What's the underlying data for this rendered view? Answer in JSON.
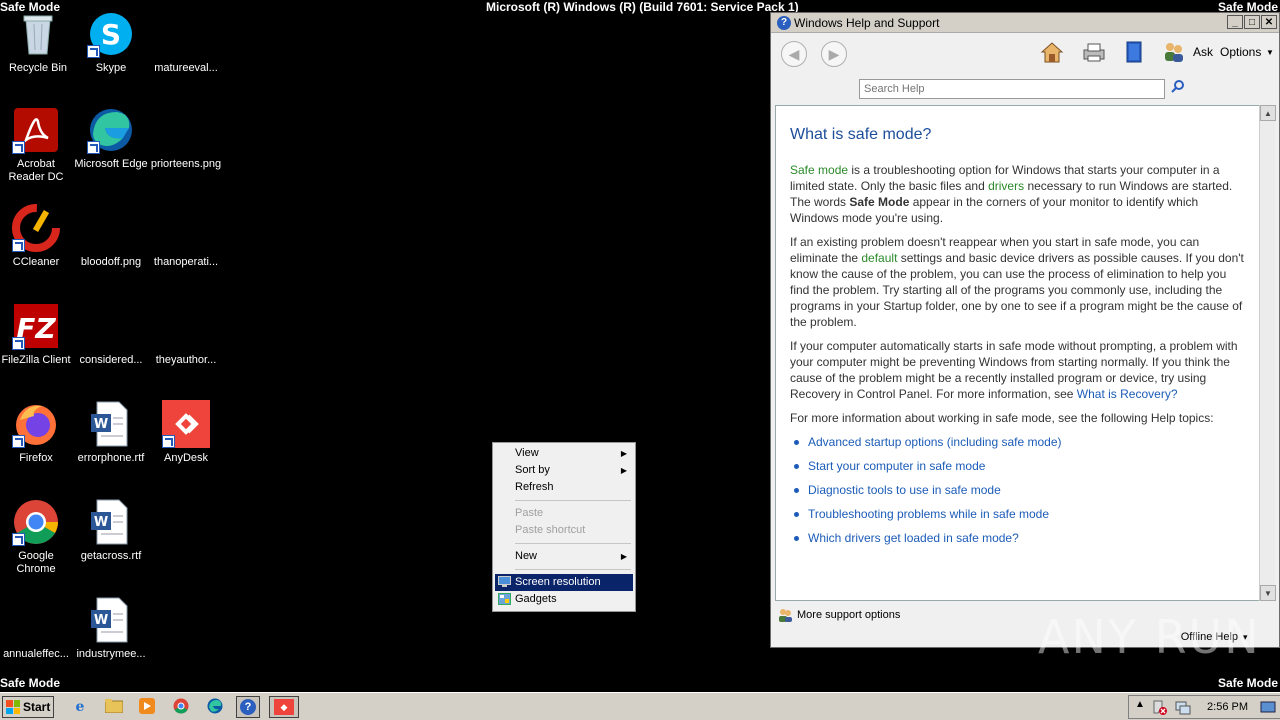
{
  "screen": {
    "safe_mode_label": "Safe Mode",
    "build_title": "Microsoft (R) Windows (R) (Build 7601: Service Pack 1)",
    "watermark": "ANY RUN"
  },
  "desktop": {
    "icons": [
      {
        "label": "Recycle Bin",
        "icon": "recycle-bin-icon"
      },
      {
        "label": "Skype",
        "icon": "skype-icon"
      },
      {
        "label": "matureeval...",
        "icon": "blank-file-icon"
      },
      {
        "label": "Acrobat Reader DC",
        "icon": "acrobat-icon"
      },
      {
        "label": "Microsoft Edge",
        "icon": "edge-icon"
      },
      {
        "label": "priorteens.png",
        "icon": "image-file-icon"
      },
      {
        "label": "CCleaner",
        "icon": "ccleaner-icon"
      },
      {
        "label": "bloodoff.png",
        "icon": "image-file-icon"
      },
      {
        "label": "thanoperati...",
        "icon": "blank-file-icon"
      },
      {
        "label": "FileZilla Client",
        "icon": "filezilla-icon"
      },
      {
        "label": "considered...",
        "icon": "blank-file-icon"
      },
      {
        "label": "theyauthor...",
        "icon": "blank-file-icon"
      },
      {
        "label": "Firefox",
        "icon": "firefox-icon"
      },
      {
        "label": "errorphone.rtf",
        "icon": "word-doc-icon"
      },
      {
        "label": "AnyDesk",
        "icon": "anydesk-icon"
      },
      {
        "label": "Google Chrome",
        "icon": "chrome-icon"
      },
      {
        "label": "getacross.rtf",
        "icon": "word-doc-icon"
      },
      {
        "label": "annualeffec...",
        "icon": "blank-file-icon"
      },
      {
        "label": "industrymee...",
        "icon": "word-doc-icon"
      }
    ]
  },
  "help_window": {
    "title": "Windows Help and Support",
    "toolbar": {
      "ask": "Ask",
      "options": "Options"
    },
    "search_placeholder": "Search Help",
    "heading": "What is safe mode?",
    "p1": {
      "link1": "Safe mode",
      "t1": " is a troubleshooting option for Windows that starts your computer in a limited state. Only the basic files and ",
      "link2": "drivers",
      "t2": " necessary to run Windows are started. The words ",
      "bold": "Safe Mode",
      "t3": " appear in the corners of your monitor to identify which Windows mode you're using."
    },
    "p2": {
      "t1": "If an existing problem doesn't reappear when you start in safe mode, you can eliminate the ",
      "link": "default",
      "t2": " settings and basic device drivers as possible causes. If you don't know the cause of the problem, you can use the process of elimination to help you find the problem. Try starting all of the programs you commonly use, including the programs in your Startup folder, one by one to see if a program might be the cause of the problem."
    },
    "p3": {
      "t1": "If your computer automatically starts in safe mode without prompting, a problem with your computer might be preventing Windows from starting normally. If you think the cause of the problem might be a recently installed program or device, try using Recovery in Control Panel. For more information, see ",
      "link": "What is Recovery?"
    },
    "p4": "For more information about working in safe mode, see the following Help topics:",
    "topics": [
      "Advanced startup options (including safe mode)",
      "Start your computer in safe mode",
      "Diagnostic tools to use in safe mode",
      "Troubleshooting problems while in safe mode",
      "Which drivers get loaded in safe mode?"
    ],
    "more_support": "More support options",
    "offline_help": "Offline Help"
  },
  "context_menu": {
    "view": "View",
    "sort_by": "Sort by",
    "refresh": "Refresh",
    "paste": "Paste",
    "paste_shortcut": "Paste shortcut",
    "new": "New",
    "screen_resolution": "Screen resolution",
    "gadgets": "Gadgets"
  },
  "taskbar": {
    "start": "Start",
    "clock": "2:56 PM"
  }
}
